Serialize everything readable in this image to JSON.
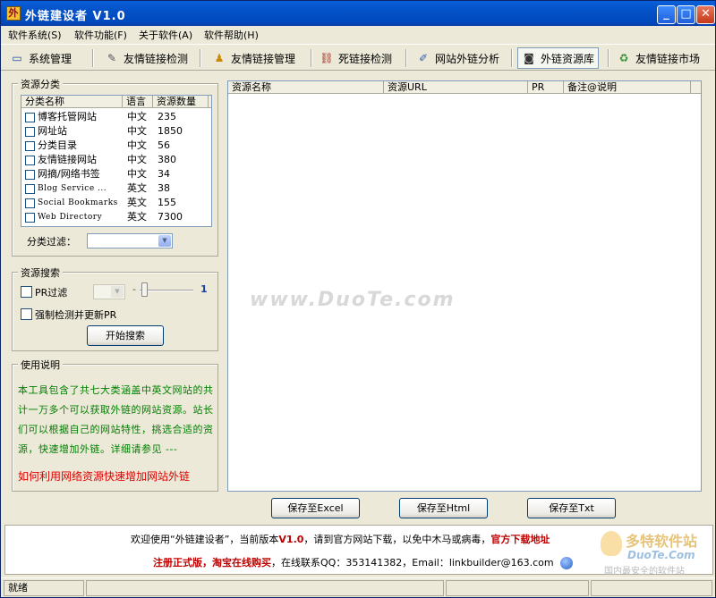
{
  "window": {
    "title": "外链建设者 V1.0",
    "icon_text": "外"
  },
  "menu": [
    "软件系统(S)",
    "软件功能(F)",
    "关于软件(A)",
    "软件帮助(H)"
  ],
  "toolbar": {
    "items": [
      {
        "label": "系统管理",
        "icon": "monitor-icon"
      },
      {
        "label": "友情链接检测",
        "icon": "pen-icon"
      },
      {
        "label": "友情链接管理",
        "icon": "user-icon"
      },
      {
        "label": "死链接检测",
        "icon": "broken-link-icon"
      },
      {
        "label": "网站外链分析",
        "icon": "analysis-icon"
      },
      {
        "label": "外链资源库",
        "icon": "database-icon"
      },
      {
        "label": "友情链接市场",
        "icon": "market-icon"
      }
    ],
    "active_index": 5
  },
  "category": {
    "group_title": "资源分类",
    "headers": [
      "分类名称",
      "语言",
      "资源数量"
    ],
    "rows": [
      {
        "name": "博客托管网站",
        "lang": "中文",
        "count": "235",
        "en": false
      },
      {
        "name": "网址站",
        "lang": "中文",
        "count": "1850",
        "en": false
      },
      {
        "name": "分类目录",
        "lang": "中文",
        "count": "56",
        "en": false
      },
      {
        "name": "友情链接网站",
        "lang": "中文",
        "count": "380",
        "en": false
      },
      {
        "name": "网摘/网络书签",
        "lang": "中文",
        "count": "34",
        "en": false
      },
      {
        "name": "Blog Service ...",
        "lang": "英文",
        "count": "38",
        "en": true
      },
      {
        "name": "Social Bookmarks",
        "lang": "英文",
        "count": "155",
        "en": true
      },
      {
        "name": "Web Directory",
        "lang": "英文",
        "count": "7300",
        "en": true
      }
    ],
    "filter_label": "分类过滤：",
    "filter_value": ""
  },
  "search": {
    "group_title": "资源搜索",
    "pr_filter_label": "PR过滤",
    "pr_value": "",
    "slider_value": "1",
    "force_label": "强制检测并更新PR",
    "start_button": "开始搜索"
  },
  "usage": {
    "group_title": "使用说明",
    "text": "本工具包含了共七大类涵盖中英文网站的共计一万多个可以获取外链的网站资源。站长们可以根据自己的网站特性，挑选合适的资源，快速增加外链。详细请参见 ---",
    "link": "如何利用网络资源快速增加网站外链"
  },
  "results": {
    "headers": [
      "资源名称",
      "资源URL",
      "PR",
      "备注@说明"
    ],
    "watermark": "www.DuoTe.com"
  },
  "buttons": {
    "excel": "保存至Excel",
    "html": "保存至Html",
    "txt": "保存至Txt"
  },
  "footer": {
    "line1_pre": "欢迎使用“外链建设者”，当前版本",
    "version": "V1.0",
    "line1_post": "，请到官方网站下载，以免中木马或病毒，",
    "download": "官方下载地址",
    "register": "注册正式版，淘宝在线购买",
    "contact": "，在线联系QQ：353141382，Email：linkbuilder@163.com",
    "logo_text": "多特软件站",
    "logo_sub": "DuoTe.Com",
    "logo_tag": "国内最安全的软件站"
  },
  "status": {
    "text": "就绪"
  },
  "colors": {
    "title_bar": "#0451C7",
    "usage_text": "#008000",
    "link_red": "#E00000",
    "version_red": "#C00000"
  }
}
